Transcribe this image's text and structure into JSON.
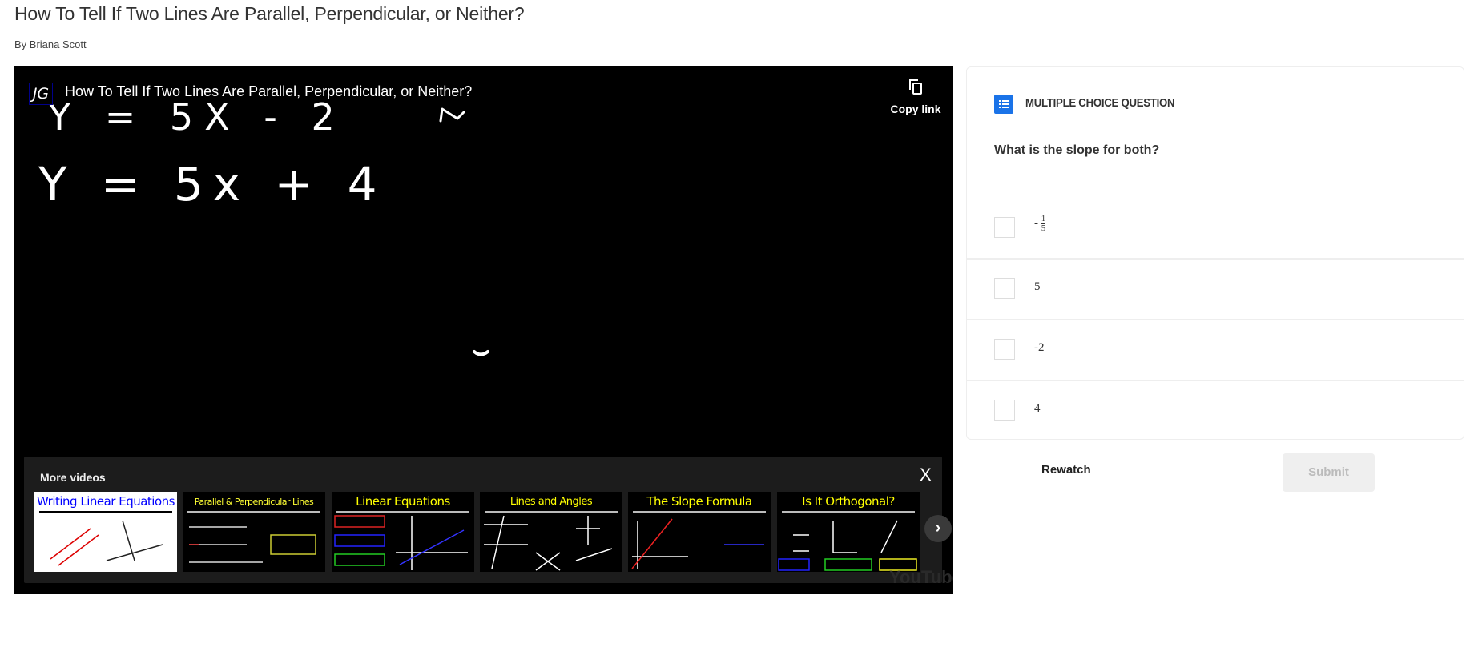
{
  "page": {
    "title": "How To Tell If Two Lines Are Parallel, Perpendicular, or Neither?",
    "byline": "By Briana Scott"
  },
  "video": {
    "channel_logo": "JG",
    "title": "How To Tell If Two Lines Are Parallel, Perpendicular, or Neither?",
    "copy_link_label": "Copy link",
    "copy_icon": "copy-icon",
    "board_equations": [
      "Y = 5X - 2",
      "Y = 5x + 4"
    ],
    "more_videos": {
      "title": "More videos",
      "close_label": "X",
      "next_label": "›",
      "items": [
        {
          "title": "Writing Linear Equations",
          "color": "#0000ff",
          "bg": "#ffffff"
        },
        {
          "title": "Parallel & Perpendicular Lines",
          "color": "#ffff33",
          "bg": "#000000"
        },
        {
          "title": "Linear Equations",
          "color": "#ffff00",
          "bg": "#000000"
        },
        {
          "title": "Lines and Angles",
          "color": "#ffff00",
          "bg": "#000000"
        },
        {
          "title": "The Slope Formula",
          "color": "#ffff00",
          "bg": "#000000"
        },
        {
          "title": "Is It Orthogonal?",
          "color": "#ffff00",
          "bg": "#000000"
        }
      ]
    },
    "watermark": "YouTube"
  },
  "quiz": {
    "type_label": "MULTIPLE CHOICE QUESTION",
    "accent": "#1a73e8",
    "question": "What is the slope for both?",
    "options": [
      {
        "sign": "-",
        "numerator": "1",
        "denominator": "5"
      },
      {
        "label": "5"
      },
      {
        "label": "-2"
      },
      {
        "label": "4"
      }
    ],
    "rewatch_label": "Rewatch",
    "submit_label": "Submit"
  }
}
